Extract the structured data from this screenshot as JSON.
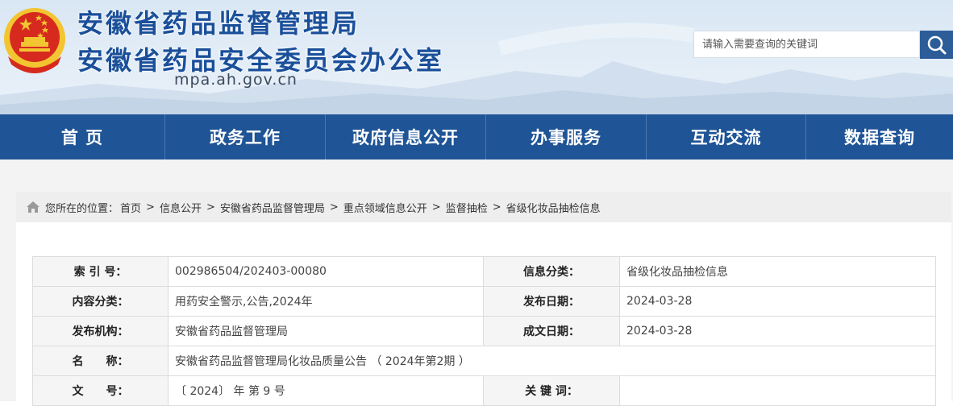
{
  "header": {
    "title_main": "安徽省药品监督管理局",
    "title_sub": "安徽省药品安全委员会办公室",
    "domain": "mpa.ah.gov.cn",
    "search": {
      "placeholder": "请输入需要查询的关键词",
      "value": ""
    },
    "emblem_icon": "national-emblem-icon",
    "search_icon": "search-icon"
  },
  "colors": {
    "brand_blue": "#1a4f9a",
    "nav_bg": "#1f5496",
    "search_btn": "#2c5d99",
    "emblem_red": "#d62a1f",
    "emblem_gold": "#f2c531"
  },
  "nav": {
    "items": [
      {
        "label": "首 页"
      },
      {
        "label": "政务工作"
      },
      {
        "label": "政府信息公开"
      },
      {
        "label": "办事服务"
      },
      {
        "label": "互动交流"
      },
      {
        "label": "数据查询"
      }
    ]
  },
  "breadcrumb": {
    "icon": "home-icon",
    "prefix": "您所在的位置：",
    "items": [
      "首页",
      "信息公开",
      "安徽省药品监督管理局",
      "重点领域信息公开",
      "监督抽检",
      "省级化妆品抽检信息"
    ],
    "separator": ">"
  },
  "meta": {
    "index_label": "索 引 号：",
    "index_value": "002986504/202403-00080",
    "info_class_label": "信息分类：",
    "info_class_value": "省级化妆品抽检信息",
    "content_class_label": "内容分类：",
    "content_class_value": "用药安全警示,公告,2024年",
    "publish_date_label": "发布日期：",
    "publish_date_value": "2024-03-28",
    "org_label": "发布机构：",
    "org_value": "安徽省药品监督管理局",
    "created_date_label": "成文日期：",
    "created_date_value": "2024-03-28",
    "name_label": "名　　称：",
    "name_value": "安徽省药品监督管理局化妆品质量公告 （ 2024年第2期 ）",
    "doc_no_label": "文　　号：",
    "doc_no_value": "〔 2024〕 年 第 9 号",
    "keywords_label": "关 键 词：",
    "keywords_value": ""
  }
}
